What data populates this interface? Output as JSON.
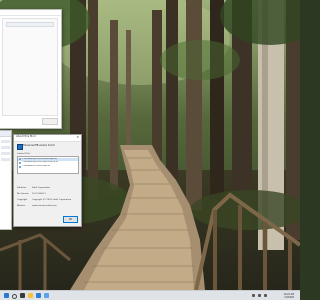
{
  "about_dialog": {
    "title": "About this Mod",
    "close_glyph": "×",
    "app_name": "TranslucentTB version 10.0.0",
    "dll_label": "Loaded DLLs",
    "dll_items": [
      "C:\\Windows\\system32\\KERNELBASE.dll",
      "C:\\Windows\\system32\\TranslucentTB.dll",
      "C:\\Windows\\SYSTEM32\\ntdll.dll"
    ],
    "info": [
      {
        "label": "Publisher",
        "value": "Sahil Corporation"
      },
      {
        "label": "File Version",
        "value": "10.0.19041.1"
      },
      {
        "label": "Copyright",
        "value": "Copyright (C) 2016, Sahil Corporation"
      },
      {
        "label": "Website",
        "value": "www.translucenttb.com"
      }
    ],
    "ok_label": "OK"
  },
  "taskbar": {
    "time": "10:24 AM",
    "date": "7/4/2020"
  },
  "icons": {
    "start": "windows-start-icon",
    "search": "search-icon",
    "taskview": "task-view-icon",
    "explorer": "file-explorer-icon",
    "app": "app-icon",
    "app2": "app-icon"
  },
  "colors": {
    "accent": "#0078d7",
    "taskbar": "#dfe3e8"
  }
}
